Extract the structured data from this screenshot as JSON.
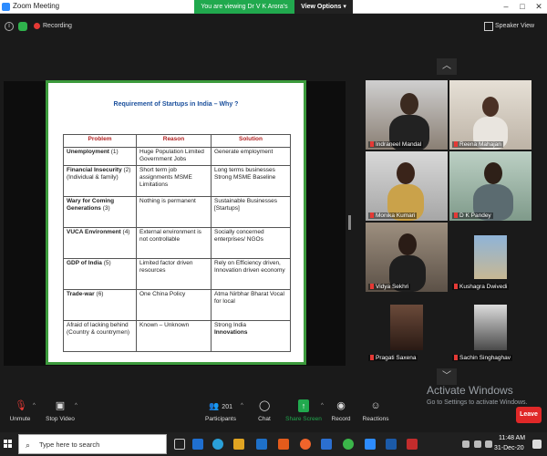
{
  "window": {
    "title": "Zoom Meeting"
  },
  "banner": {
    "viewing_text": "You are viewing Dr V K Arora's screen",
    "view_options": "View Options ▾"
  },
  "status": {
    "recording_label": "Recording",
    "speaker_view_label": "Speaker View"
  },
  "slide": {
    "title": "Requirement of Startups in India – Why ?",
    "headers": [
      "Problem",
      "Reason",
      "Solution"
    ],
    "rows": [
      {
        "problem_bold": "Unemployment",
        "problem_rest": " (1)",
        "reason": "Huge Population Limited Government Jobs",
        "solution": "Generate employment"
      },
      {
        "problem_bold": "Financial Insecurity",
        "problem_rest": " (2) (Individual & family)",
        "reason": "Short term job assignments MSME Limitations",
        "solution": "Long terms businesses Strong MSME Baseline"
      },
      {
        "problem_bold": "Wary for Coming Generations",
        "problem_rest": " (3)",
        "reason": "Nothing is permanent",
        "solution": "Sustainable Businesses [Startups]"
      },
      {
        "problem_bold": "VUCA Environment",
        "problem_rest": " (4)",
        "reason": "External environment is not controllable",
        "solution": "Socially concerned enterprises/ NGOs"
      },
      {
        "problem_bold": "GDP of India",
        "problem_rest": " (5)",
        "reason": "Limited factor driven resources",
        "solution": "Rely on Efficiency driven, Innovation driven economy"
      },
      {
        "problem_bold": "Trade-war",
        "problem_rest": " (6)",
        "reason": "One China Policy",
        "solution": "Atma Nirbhar Bharat Vocal for local"
      },
      {
        "problem_bold": "",
        "problem_rest": "Afraid of lacking behind (Country & countrymen)",
        "reason": "Known – Unknown",
        "solution": "Strong India",
        "solution_bold": "Innovations"
      }
    ]
  },
  "participants": [
    {
      "name": "Indraneel Mandal"
    },
    {
      "name": "Reena Mahajan"
    },
    {
      "name": "Monika Kumari"
    },
    {
      "name": "D K Pandey"
    },
    {
      "name": "Vidya Sekhri"
    },
    {
      "name": "Kushagra Dwivedi"
    },
    {
      "name": "Pragati Saxena"
    },
    {
      "name": "Sachin Singhaghav"
    }
  ],
  "activate": {
    "title": "Activate Windows",
    "subtitle": "Go to Settings to activate Windows."
  },
  "toolbar": {
    "unmute": "Unmute",
    "stop_video": "Stop Video",
    "participants_count": "201",
    "participants": "Participants",
    "chat": "Chat",
    "share_screen": "Share Screen",
    "record": "Record",
    "reactions": "Reactions",
    "leave": "Leave"
  },
  "taskbar": {
    "search_placeholder": "Type here to search",
    "time": "11:48 AM",
    "date": "31-Dec-20"
  },
  "colors": {
    "share_green": "#21a94e",
    "leave_red": "#e02828",
    "slide_border": "#3c9a3c",
    "header_red": "#b22222"
  }
}
